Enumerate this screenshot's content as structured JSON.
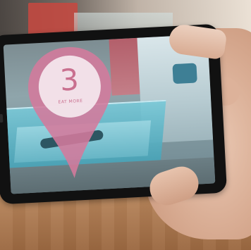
{
  "ar_marker": {
    "number": "3",
    "caption": "EAT MORE",
    "color": "#d47a9c"
  },
  "colors": {
    "pin_fill": "#d47a9c",
    "pin_inner": "#f3e6ec",
    "phone_body": "#111111",
    "floor": "#a8764e"
  }
}
